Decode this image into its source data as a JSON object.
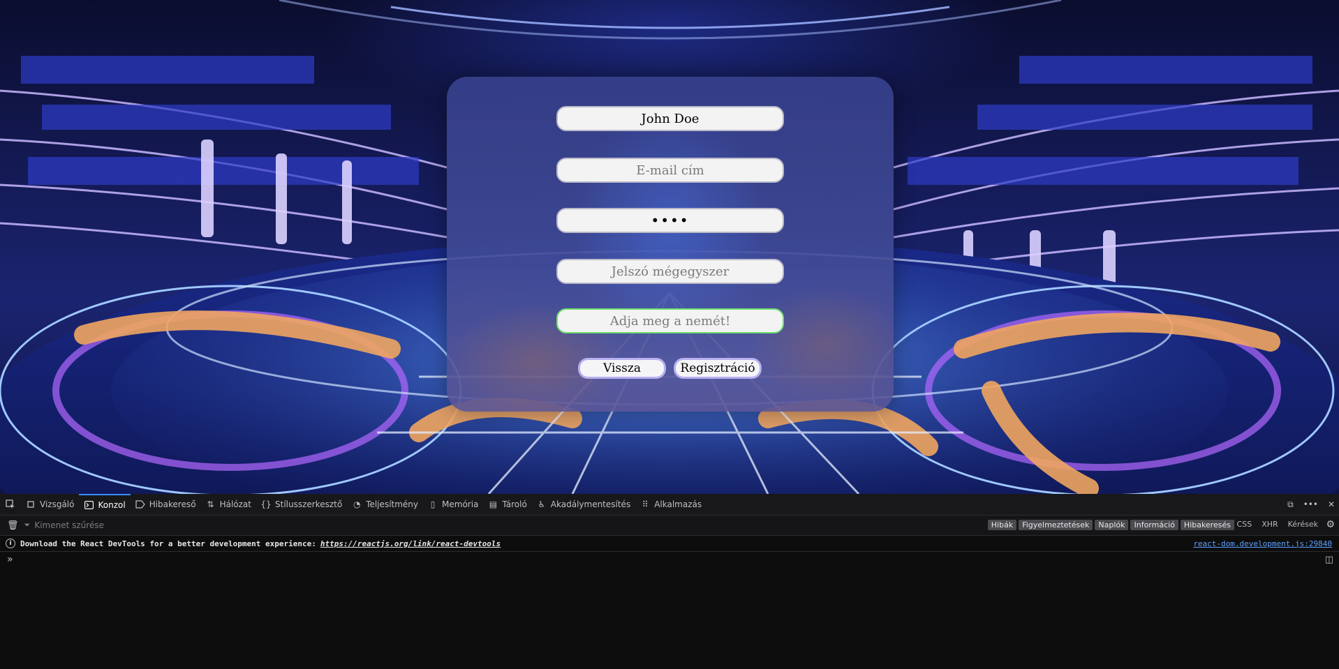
{
  "form": {
    "name_value": "John Doe",
    "email_placeholder": "E-mail cím",
    "password_value": "1234",
    "password_confirm_placeholder": "Jelszó mégegyszer",
    "gender_placeholder": "Adja meg a nemét!",
    "back_label": "Vissza",
    "register_label": "Regisztráció"
  },
  "devtools": {
    "tabs": [
      {
        "label": "Vizsgáló",
        "icon": "inspector-icon"
      },
      {
        "label": "Konzol",
        "icon": "console-icon",
        "active": true
      },
      {
        "label": "Hibakereső",
        "icon": "debugger-icon"
      },
      {
        "label": "Hálózat",
        "icon": "network-icon"
      },
      {
        "label": "Stílusszerkesztő",
        "icon": "style-editor-icon"
      },
      {
        "label": "Teljesítmény",
        "icon": "performance-icon"
      },
      {
        "label": "Memória",
        "icon": "memory-icon"
      },
      {
        "label": "Tároló",
        "icon": "storage-icon"
      },
      {
        "label": "Akadálymentesítés",
        "icon": "accessibility-icon"
      },
      {
        "label": "Alkalmazás",
        "icon": "application-icon"
      }
    ],
    "filter_placeholder": "Kimenet szűrése",
    "levels": [
      "Hibák",
      "Figyelmeztetések",
      "Naplók",
      "Információ",
      "Hibakeresés"
    ],
    "request_filters": [
      "CSS",
      "XHR",
      "Kérések"
    ],
    "message": {
      "text": "Download the React DevTools for a better development experience:",
      "link": "https://reactjs.org/link/react-devtools",
      "source": "react-dom.development.js:29840"
    }
  },
  "colors": {
    "focus_border": "#6cdf6c",
    "button_border": "#b6b0f0",
    "devtools_active_tab": "#3a8dff",
    "source_link": "#5ea1ff"
  }
}
